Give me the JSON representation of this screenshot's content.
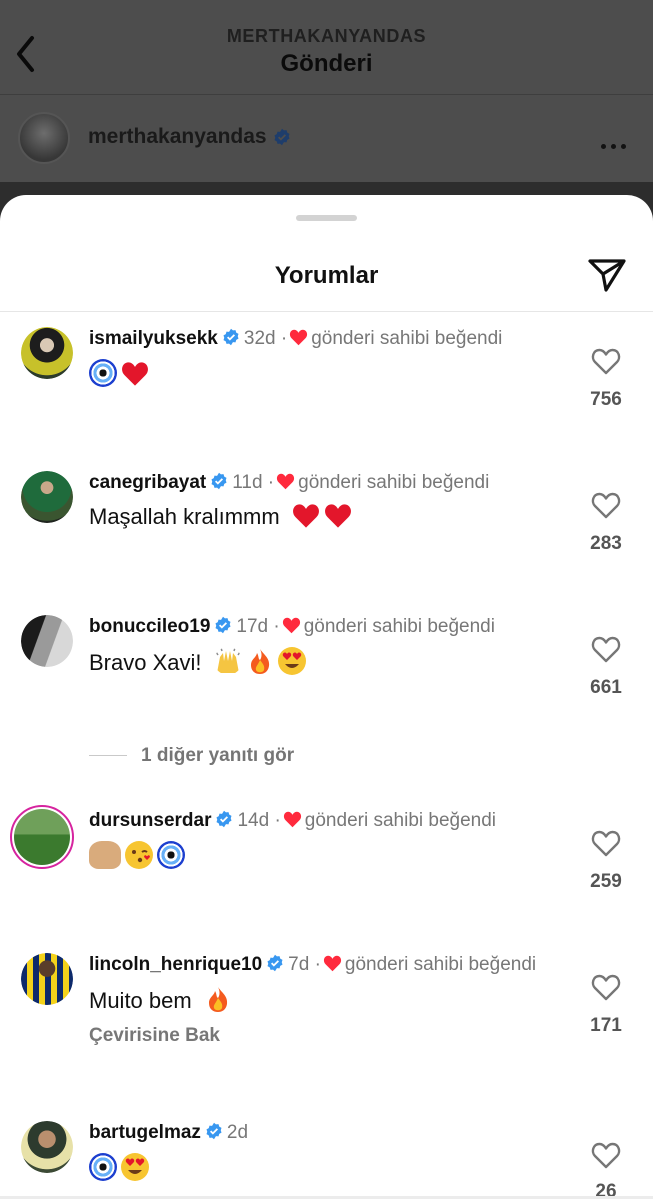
{
  "header": {
    "subtitle": "MERTHAKANYANDAS",
    "title": "Gönderi"
  },
  "post": {
    "author": "merthakanyandas"
  },
  "sheet": {
    "title": "Yorumlar"
  },
  "comments": [
    {
      "username": "ismailyuksekk",
      "age": "32d",
      "liked_by_owner": "gönderi sahibi beğendi",
      "text": "",
      "emojis": [
        "nazar",
        "heart"
      ],
      "likes": "756"
    },
    {
      "username": "canegribayat",
      "age": "11d",
      "liked_by_owner": "gönderi sahibi beğendi",
      "text": "Maşallah kralımmm",
      "emojis": [
        "heart",
        "heart"
      ],
      "likes": "283"
    },
    {
      "username": "bonuccileo19",
      "age": "17d",
      "liked_by_owner": "gönderi sahibi beğendi",
      "text": "Bravo Xavi!",
      "emojis": [
        "raised-hands",
        "fire",
        "heart-eyes"
      ],
      "likes": "661"
    },
    {
      "username": "dursunserdar",
      "age": "14d",
      "liked_by_owner": "gönderi sahibi beğendi",
      "text": "",
      "emojis": [
        "palms-up",
        "kiss",
        "nazar"
      ],
      "likes": "259"
    },
    {
      "username": "lincoln_henrique10",
      "age": "7d",
      "liked_by_owner": "gönderi sahibi beğendi",
      "text": "Muito bem",
      "emojis": [
        "fire"
      ],
      "likes": "171",
      "translate": "Çevirisine Bak"
    },
    {
      "username": "bartugelmaz",
      "age": "2d",
      "liked_by_owner": "",
      "text": "",
      "emojis": [
        "nazar",
        "heart-eyes"
      ],
      "likes": "26"
    }
  ],
  "more_replies": "1 diğer yanıtı gör",
  "colors": {
    "verified": "#3897f0",
    "heart": "#ff2a3d",
    "muted": "#777777"
  }
}
